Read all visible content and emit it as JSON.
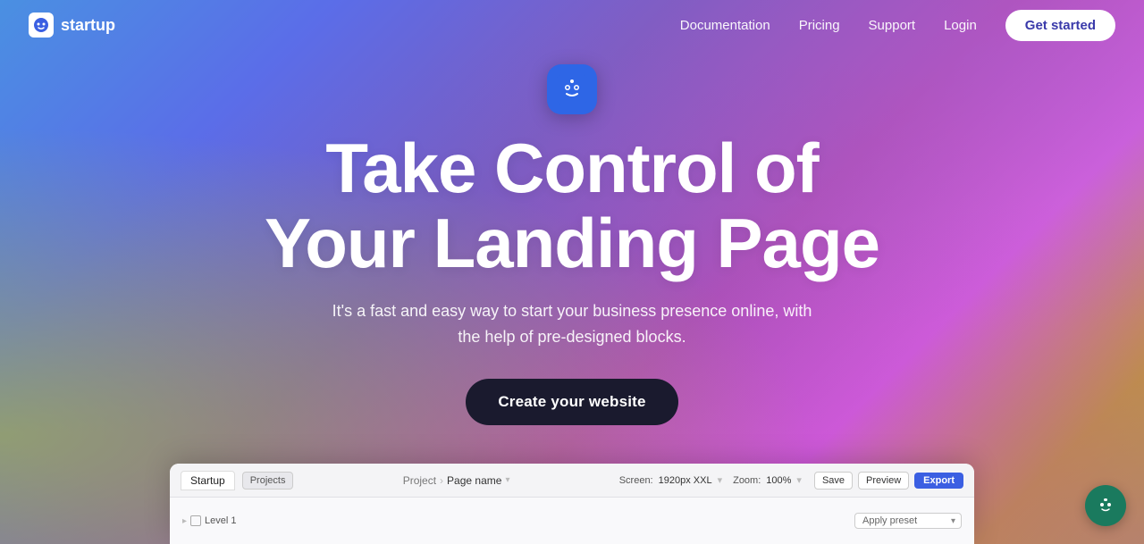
{
  "brand": {
    "logo_text": "startup",
    "logo_icon": "☺"
  },
  "nav": {
    "links": [
      {
        "label": "Documentation",
        "id": "doc"
      },
      {
        "label": "Pricing",
        "id": "pricing"
      },
      {
        "label": "Support",
        "id": "support"
      },
      {
        "label": "Login",
        "id": "login"
      }
    ],
    "cta_label": "Get started"
  },
  "hero": {
    "title_line1": "Take Control of",
    "title_line2": "Your Landing Page",
    "subtitle": "It's a fast and easy way to start your business presence online, with the help of pre-designed blocks.",
    "cta_label": "Create your website"
  },
  "editor": {
    "tab_startup": "Startup",
    "tab_projects": "Projects",
    "breadcrumb_project": "Project",
    "breadcrumb_page": "Page name",
    "screen_label": "Screen:",
    "screen_value": "1920px XXL",
    "zoom_label": "Zoom:",
    "zoom_value": "100%",
    "save_label": "Save",
    "preview_label": "Preview",
    "export_label": "Export",
    "level_label": "Level 1",
    "preset_label": "Apply preset"
  },
  "fab": {
    "icon": "☺"
  },
  "colors": {
    "cta_bg": "#1a1a2e",
    "nav_cta_bg": "#ffffff",
    "export_bg": "#3b5fe2",
    "fab_bg": "#1a7a5e"
  }
}
